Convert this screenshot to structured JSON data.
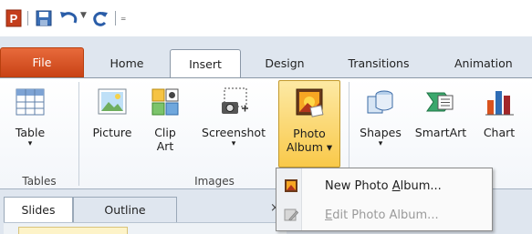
{
  "qat": {
    "app_icon": "powerpoint-icon",
    "save_icon": "save-icon",
    "undo_icon": "undo-icon",
    "redo_icon": "redo-icon",
    "customize_icon": "customize-qat-icon"
  },
  "tabs": [
    {
      "label": "File"
    },
    {
      "label": "Home"
    },
    {
      "label": "Insert"
    },
    {
      "label": "Design"
    },
    {
      "label": "Transitions"
    },
    {
      "label": "Animation"
    }
  ],
  "ribbon": {
    "table": {
      "label": "Table",
      "arrow": "▾"
    },
    "picture": {
      "label": "Picture"
    },
    "clipart": {
      "label": "Clip\nArt"
    },
    "screenshot": {
      "label": "Screenshot",
      "arrow": "▾"
    },
    "photoalbum": {
      "label": "Photo\nAlbum ▾"
    },
    "shapes": {
      "label": "Shapes",
      "arrow": "▾"
    },
    "smartart": {
      "label": "SmartArt"
    },
    "chart": {
      "label": "Chart"
    },
    "groups": {
      "tables": "Tables",
      "images": "Images"
    }
  },
  "pane": {
    "tabs": [
      {
        "label": "Slides"
      },
      {
        "label": "Outline"
      }
    ],
    "close": "×"
  },
  "menu": {
    "items": [
      {
        "label_pre": "New Photo ",
        "label_u": "A",
        "label_post": "lbum...",
        "icon": "new-photo-album-icon",
        "enabled": true
      },
      {
        "label_pre": "",
        "label_u": "E",
        "label_post": "dit Photo Album...",
        "icon": "edit-photo-album-icon",
        "enabled": false
      }
    ]
  },
  "colors": {
    "file_tab": "#d85a27",
    "selected_button": "#f9c94a",
    "tab_strip": "#dfe6ef"
  }
}
